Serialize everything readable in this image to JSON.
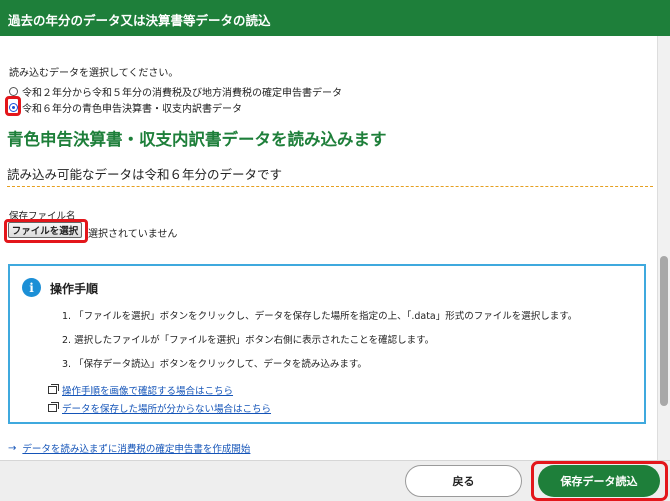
{
  "window": {
    "title": "過去の年分のデータ又は決算書等データの読込"
  },
  "prompt": "読み込むデータを選択してください。",
  "options": [
    {
      "label": "令和２年分から令和５年分の消費税及び地方消費税の確定申告書データ",
      "selected": false
    },
    {
      "label": "令和６年分の青色申告決算書・収支内訳書データ",
      "selected": true
    }
  ],
  "section": {
    "title": "青色申告決算書・収支内訳書データを読み込みます",
    "subtitle": "読み込み可能なデータは令和６年分のデータです"
  },
  "file": {
    "label": "保存ファイル名",
    "button_label": "ファイルを選択",
    "status": "選択されていません"
  },
  "info": {
    "icon": "info-icon",
    "title": "操作手順",
    "steps": [
      "1. 「ファイルを選択」ボタンをクリックし、データを保存した場所を指定の上、「.data」形式のファイルを選択します。",
      "2. 選択したファイルが「ファイルを選択」ボタン右側に表示されたことを確認します。",
      "3. 「保存データ読込」ボタンをクリックして、データを読み込みます。"
    ],
    "links": [
      "操作手順を画像で確認する場合はこちら",
      "データを保存した場所が分からない場合はこちら"
    ]
  },
  "bottom_link": "データを読み込まずに消費税の確定申告書を作成開始",
  "footer": {
    "back_label": "戻る",
    "save_label": "保存データ読込"
  },
  "colors": {
    "brand_green": "#1e7f3a",
    "highlight_red": "#e3161b",
    "info_border": "#3fa9de",
    "link_blue": "#1454b8",
    "divider_orange": "#e6a020"
  }
}
